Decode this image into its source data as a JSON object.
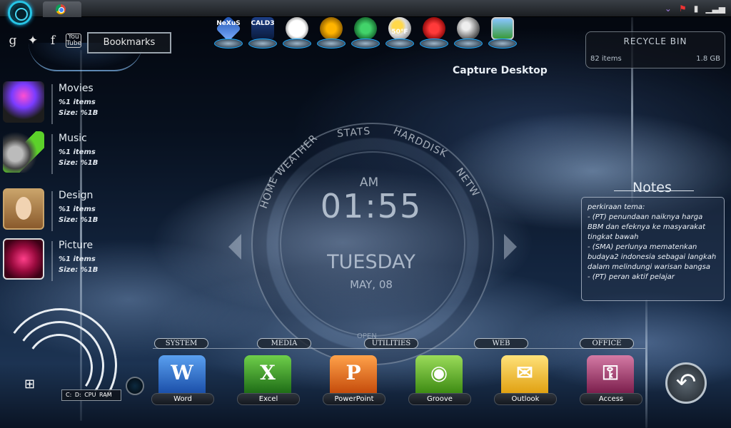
{
  "taskbar": {
    "start_icon": "start-orb-icon",
    "tab_icon": "chrome-icon",
    "tray_icons": [
      "chevron-down-icon",
      "flag-icon",
      "battery-icon",
      "signal-icon"
    ]
  },
  "social": {
    "items": [
      {
        "glyph": "g",
        "name": "google-icon"
      },
      {
        "glyph": "✦",
        "name": "owl-icon"
      },
      {
        "glyph": "f",
        "name": "facebook-icon"
      },
      {
        "glyph": "You\nTube",
        "name": "youtube-icon"
      }
    ],
    "bookmarks_label": "Bookmarks"
  },
  "folders": [
    {
      "title": "Movies",
      "items": "%1 items",
      "size": "Size: %1B"
    },
    {
      "title": "Music",
      "items": "%1 items",
      "size": "Size: %1B"
    },
    {
      "title": "Design",
      "items": "%1 items",
      "size": "Size: %1B"
    },
    {
      "title": "Picture",
      "items": "%1 items",
      "size": "Size: %1B"
    }
  ],
  "top_dock": {
    "items": [
      {
        "name": "nexus-icon",
        "text": "NeXuS"
      },
      {
        "name": "cald3-icon",
        "text": "CALD3"
      },
      {
        "name": "clock-icon",
        "text": ""
      },
      {
        "name": "aimp-icon",
        "text": ""
      },
      {
        "name": "recycle-icon",
        "text": ""
      },
      {
        "name": "weather-icon",
        "text": "50°F"
      },
      {
        "name": "hazard-icon",
        "text": ""
      },
      {
        "name": "globe-icon",
        "text": ""
      },
      {
        "name": "photo-icon",
        "text": ""
      }
    ]
  },
  "recycle_bin": {
    "title": "RECYCLE BIN",
    "items": "82 items",
    "size": "1.8 GB"
  },
  "capture_label": "Capture Desktop",
  "notes": {
    "title": "Notes",
    "text": "perkiraan tema:\n- (PT) penundaan naiknya harga BBM dan efeknya ke masyarakat tingkat bawah\n- (SMA) perlunya mematenkan budaya2 indonesia sebagai langkah dalam melindungi warisan bangsa\n- (PT) peran aktif pelajar"
  },
  "clock": {
    "ring": {
      "home": "HOME",
      "weather": "WEATHER",
      "stats": "STATS",
      "harddisk": "HARDDISK",
      "network": "NETW"
    },
    "ampm": "AM",
    "time": "01:55",
    "day": "TUESDAY",
    "date": "MAY, 08",
    "open": "OPEN"
  },
  "categories": [
    "SYSTEM",
    "MEDIA",
    "UTILITIES",
    "WEB",
    "OFFICE"
  ],
  "apps": [
    {
      "label": "Word",
      "glyph": "W"
    },
    {
      "label": "Excel",
      "glyph": "X"
    },
    {
      "label": "PowerPoint",
      "glyph": "P"
    },
    {
      "label": "Groove",
      "glyph": "◉"
    },
    {
      "label": "Outlook",
      "glyph": "✉"
    },
    {
      "label": "Access",
      "glyph": "⚿"
    }
  ],
  "meter": {
    "labels": "C:  D:  CPU  RAM"
  },
  "back_button": {
    "glyph": "↶"
  }
}
